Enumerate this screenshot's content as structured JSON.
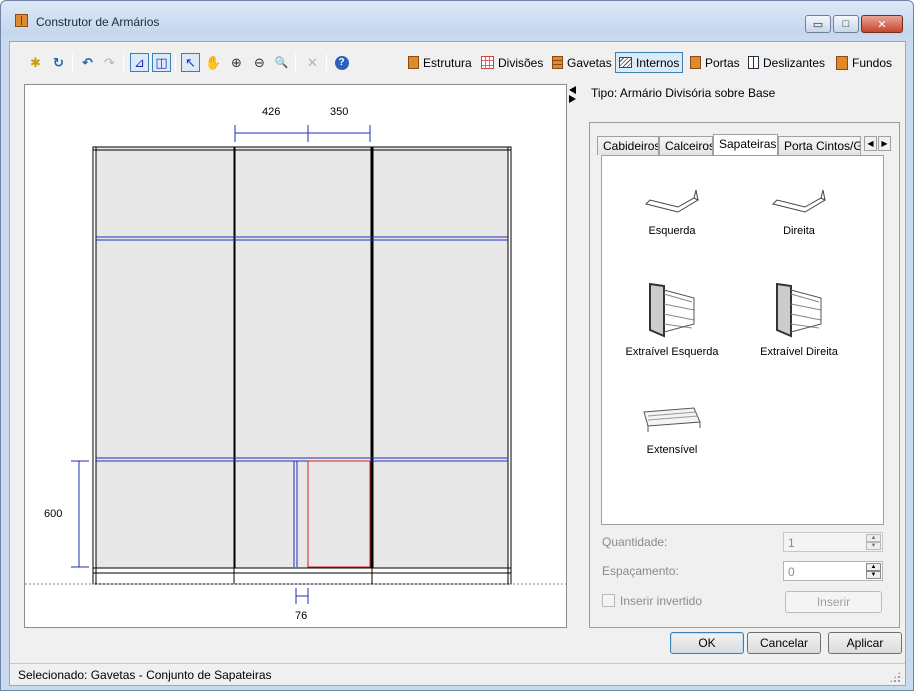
{
  "window": {
    "title": "Construtor de Armários",
    "minimize_glyph": "▭",
    "maximize_glyph": "□",
    "close_glyph": "✕"
  },
  "toolbar": {
    "icons": {
      "new": "✱",
      "refresh": "↻",
      "undo": "↶",
      "redo": "↷",
      "view_a": "⊿",
      "view_b": "◫",
      "select": "↖",
      "pan": "✋",
      "zoom_in": "⊕",
      "zoom_out": "⊖",
      "zoom_fit": "🔍",
      "delete": "✕",
      "help": "?"
    },
    "items": {
      "estrutura": "Estrutura",
      "divisoes": "Divisões",
      "gavetas": "Gavetas",
      "internos": "Internos",
      "portas": "Portas",
      "deslizantes": "Deslizantes",
      "fundos": "Fundos"
    }
  },
  "drawing": {
    "dim_top_left": "426",
    "dim_top_right": "350",
    "dim_left": "600",
    "dim_bottom": "76",
    "colors": {
      "frame": "#000000",
      "division": "#1f2dbf",
      "selection": "#d22020",
      "panel_fill": "#e8e8e8"
    }
  },
  "info": {
    "tipo": "Tipo: Armário Divisória sobre Base"
  },
  "tabs": {
    "cabideiros": "Cabideiros",
    "calceiros": "Calceiros",
    "sapateiras": "Sapateiras",
    "porta_cintos": "Porta Cintos/Gra",
    "scroll_left": "◀",
    "scroll_right": "▶"
  },
  "sapateiras": {
    "esquerda": "Esquerda",
    "direita": "Direita",
    "extraivel_esquerda": "Extraível Esquerda",
    "extraivel_direita": "Extraível Direita",
    "extensivel": "Extensível"
  },
  "form": {
    "quantidade_label": "Quantidade:",
    "quantidade_value": "1",
    "espacamento_label": "Espaçamento:",
    "espacamento_value": "0",
    "inserir_invertido": "Inserir invertido",
    "inserir": "Inserir",
    "spin_up": "▲",
    "spin_down": "▼"
  },
  "buttons": {
    "ok": "OK",
    "cancelar": "Cancelar",
    "aplicar": "Aplicar"
  },
  "status": {
    "text": "Selecionado: Gavetas - Conjunto de Sapateiras"
  }
}
